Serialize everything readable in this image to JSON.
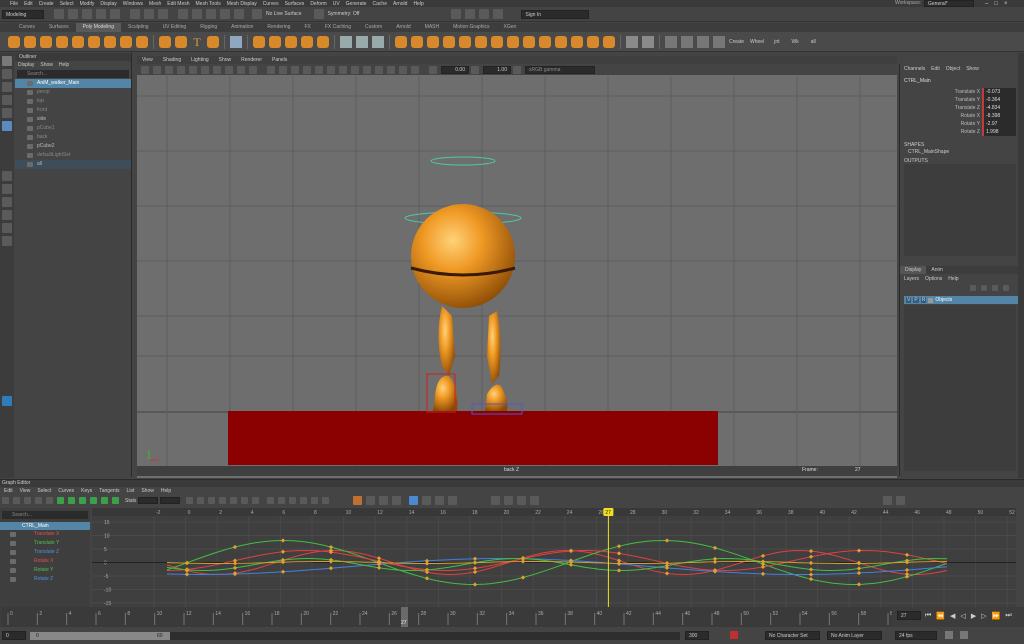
{
  "menubar": [
    "File",
    "Edit",
    "Create",
    "Select",
    "Modify",
    "Display",
    "Windows",
    "Mesh",
    "Edit Mesh",
    "Mesh Tools",
    "Mesh Display",
    "Curves",
    "Surfaces",
    "Deform",
    "UV",
    "Generate",
    "Cache",
    "Arnold",
    "Help"
  ],
  "status": {
    "mode": "Modeling",
    "live": "No Live Surface",
    "symmetry": "Symmetry: Off",
    "signin": "Sign In",
    "workspace_label": "Workspace:",
    "workspace": "General*"
  },
  "shelf_tabs": [
    "Curves",
    "Surfaces",
    "Poly Modeling",
    "Sculpting",
    "UV Editing",
    "Rigging",
    "Animation",
    "Rendering",
    "FX",
    "FX Caching",
    "Custom",
    "Arnold",
    "MASH",
    "Motion Graphics",
    "XGen"
  ],
  "shelf_active": "Poly Modeling",
  "shelf_buttons": [
    "Create",
    "Wheel",
    "jnt",
    "Wk",
    "all"
  ],
  "outliner": {
    "title": "Outliner",
    "menu": [
      "Display",
      "Show",
      "Help"
    ],
    "search": "Search...",
    "items": [
      {
        "label": "AniM_walker_Main",
        "state": "sel"
      },
      {
        "label": "persp",
        "state": "dim"
      },
      {
        "label": "top",
        "state": "dim"
      },
      {
        "label": "front",
        "state": "dim"
      },
      {
        "label": "side",
        "state": "normal"
      },
      {
        "label": "pCube1",
        "state": "dim"
      },
      {
        "label": "back",
        "state": "dim"
      },
      {
        "label": "pCube2",
        "state": "normal"
      },
      {
        "label": "defaultLightSet",
        "state": "dim"
      },
      {
        "label": "all",
        "state": "normal"
      }
    ]
  },
  "viewport": {
    "menu": [
      "View",
      "Shading",
      "Lighting",
      "Show",
      "Renderer",
      "Panels"
    ],
    "field1": "0.00",
    "field2": "1.00",
    "colorspace": "sRGB gamma",
    "camera": "back Z",
    "frame_label": "Frame:",
    "frame": "27"
  },
  "channel_box": {
    "menu": [
      "Channels",
      "Edit",
      "Object",
      "Show"
    ],
    "object": "CTRL_Main",
    "channels": [
      {
        "name": "Translate X",
        "value": "-0.073"
      },
      {
        "name": "Translate Y",
        "value": "-0.364"
      },
      {
        "name": "Translate Z",
        "value": "-4.834"
      },
      {
        "name": "Rotate X",
        "value": "-8.398"
      },
      {
        "name": "Rotate Y",
        "value": "-2.97"
      },
      {
        "name": "Rotate Z",
        "value": "1.998"
      }
    ],
    "shapes_label": "SHAPES",
    "shape": "CTRL_MainShape",
    "outputs_label": "OUTPUTS",
    "output": "motionTrail1"
  },
  "layers": {
    "tabs": [
      "Display",
      "Anim"
    ],
    "menu": [
      "Layers",
      "Options",
      "Help"
    ],
    "layer": "Objects",
    "flags": [
      "V",
      "P",
      "R"
    ]
  },
  "graph_editor": {
    "title": "Graph Editor",
    "menu": [
      "Edit",
      "View",
      "Select",
      "Curves",
      "Keys",
      "Tangents",
      "List",
      "Show",
      "Help"
    ],
    "stats": "Stats",
    "search": "Search...",
    "node": "CTRL_Main",
    "curves": [
      {
        "name": "Translate X",
        "color": "#e04040"
      },
      {
        "name": "Translate Y",
        "color": "#40c040"
      },
      {
        "name": "Translate Z",
        "color": "#4080e0"
      },
      {
        "name": "Rotate X",
        "color": "#e04040"
      },
      {
        "name": "Rotate Y",
        "color": "#40c040"
      },
      {
        "name": "Rotate Z",
        "color": "#4080e0"
      }
    ],
    "frame_ticks": [
      "-2",
      "0",
      "2",
      "4",
      "6",
      "8",
      "10",
      "12",
      "14",
      "16",
      "18",
      "20",
      "22",
      "24",
      "26",
      "28",
      "30",
      "32",
      "34",
      "36",
      "38",
      "40",
      "42",
      "44",
      "46",
      "48",
      "50",
      "52"
    ],
    "value_ticks": [
      "15",
      "10",
      "5",
      "0",
      "-5",
      "-10",
      "-15"
    ],
    "current_frame": "27"
  },
  "timeline": {
    "ticks": [
      "0",
      "2",
      "4",
      "6",
      "8",
      "10",
      "12",
      "14",
      "16",
      "18",
      "20",
      "22",
      "24",
      "26",
      "28",
      "30",
      "32",
      "34",
      "36",
      "38",
      "40",
      "42",
      "44",
      "46",
      "48",
      "50",
      "52",
      "54",
      "56",
      "58",
      "60"
    ],
    "current": "27",
    "current_field": "27"
  },
  "range": {
    "start": "0",
    "slider_start": "0",
    "slider_end": "60",
    "end": "300",
    "character_set": "No Character Set",
    "anim_layer": "No Anim Layer",
    "fps": "24 fps"
  }
}
